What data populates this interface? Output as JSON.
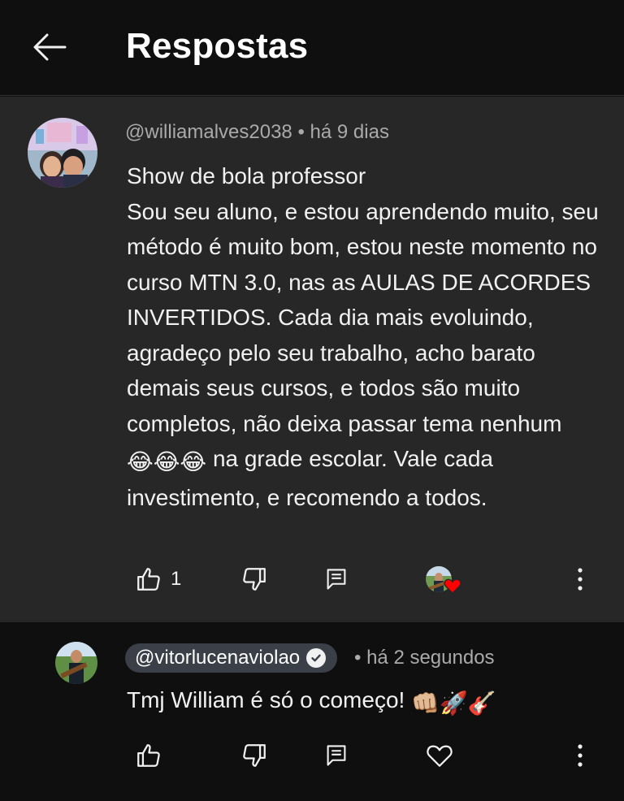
{
  "header": {
    "title": "Respostas",
    "back_icon": "arrow-left-icon"
  },
  "comment": {
    "handle": "@williamalves2038",
    "separator": " • ",
    "time": "há 9 dias",
    "line1": "Show de bola professor",
    "body_before_emoji": "Sou seu aluno, e estou aprendendo muito, seu método é muito bom, estou neste momento no curso MTN 3.0, nas as AULAS DE ACORDES INVERTIDOS. Cada dia mais evoluindo, agradeço pelo seu trabalho, acho barato demais seus cursos, e todos são muito completos, não deixa passar tema nenhum",
    "emoji": "😂😂😂",
    "body_after_emoji": "na grade escolar. Vale cada investimento, e recomendo a todos.",
    "likes": "1",
    "icons": [
      "thumbs-up-icon",
      "thumbs-down-icon",
      "reply-icon",
      "creator-heart-icon",
      "more-vert-icon"
    ]
  },
  "reply": {
    "handle": "@vitorlucenaviolao",
    "separator": " • ",
    "time": "há 2 segundos",
    "text": "Tmj William é só o começo!",
    "emoji": "👊🏼🚀🎸",
    "icons": [
      "thumbs-up-icon",
      "thumbs-down-icon",
      "reply-icon",
      "heart-outline-icon",
      "more-vert-icon"
    ]
  },
  "colors": {
    "background": "#0f0f0f",
    "comment_background": "#272727",
    "text": "#f1f1f1",
    "meta": "#aaaaaa",
    "chip": "#3a3f48",
    "heart": "#ff0000"
  }
}
